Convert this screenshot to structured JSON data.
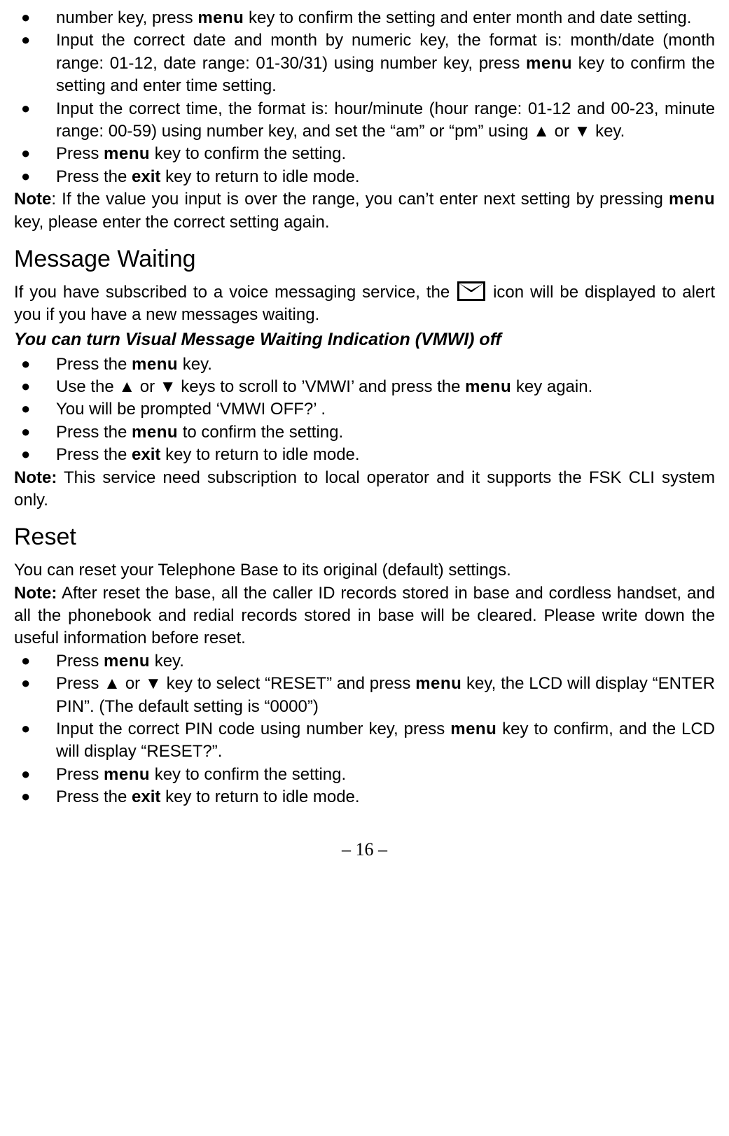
{
  "section1": {
    "cont": {
      "pre": "number key, press ",
      "menu": "menu",
      "post": " key to confirm the setting and enter month and date setting."
    },
    "items": [
      {
        "pre": "Input the correct date and month by numeric key, the format is: month/date (month range: 01-12, date range: 01-30/31) using number key, press ",
        "menu": "menu",
        "post": " key to confirm the setting and enter time setting."
      },
      {
        "full": "Input the correct time, the format is: hour/minute (hour range: 01-12 and 00-23, minute range: 00-59) using number key, and set the “am” or “pm” using ▲ or ▼ key."
      },
      {
        "pre": "Press ",
        "menu": "menu",
        "post": " key to confirm the setting."
      },
      {
        "pre": "Press the ",
        "bold": "exit",
        "post": " key to return to idle mode."
      }
    ],
    "note": {
      "label": "Note",
      "pre": ": If the value you input is over the range, you can’t enter next setting by pressing ",
      "menu": "menu",
      "post": " key, please enter the correct setting again."
    }
  },
  "section2": {
    "heading": "Message Waiting",
    "intro": {
      "pre": "If you have subscribed to a voice messaging service, the ",
      "post": " icon will be displayed to alert you if you have a new messages waiting."
    },
    "subheading": "You can turn Visual Message Waiting Indication (VMWI) off",
    "items": [
      {
        "pre": "Press the ",
        "menu": "menu",
        "post": " key."
      },
      {
        "pre": "Use the ▲ or ▼ keys to scroll to ’VMWI’ and press the  ",
        "menu": "menu",
        "post": " key again."
      },
      {
        "full": "You will be prompted ‘VMWI OFF?’  ."
      },
      {
        "pre": "Press the ",
        "menu": "menu",
        "post": " to confirm the setting."
      },
      {
        "pre": "Press the ",
        "bold": "exit",
        "post": " key to return to idle mode."
      }
    ],
    "note": {
      "label": "Note:",
      "post": " This service need subscription to local operator and it supports the FSK CLI system only."
    }
  },
  "section3": {
    "heading": "Reset",
    "intro": "You can reset your Telephone Base to its original (default) settings.",
    "note": {
      "label": "Note:",
      "post": " After reset the base, all the caller ID records stored in base and cordless handset, and all the phonebook and redial records stored in base will be cleared. Please write down the useful information before reset."
    },
    "items": [
      {
        "pre": "Press ",
        "menu": "menu",
        "post": " key."
      },
      {
        "pre": "Press ▲ or ▼ key to select “RESET” and press ",
        "menu": "menu",
        "post": " key, the LCD will display “ENTER PIN”. (The default setting is “0000”)"
      },
      {
        "pre": "Input the correct PIN code using number key, press ",
        "menu": "menu",
        "post": " key to confirm, and the LCD will display “RESET?”."
      },
      {
        "pre": "Press ",
        "menu": "menu",
        "post": " key to confirm the setting."
      },
      {
        "pre": "Press the ",
        "bold": "exit",
        "post": " key to return to idle mode."
      }
    ]
  },
  "pageNumber": "– 16 –"
}
